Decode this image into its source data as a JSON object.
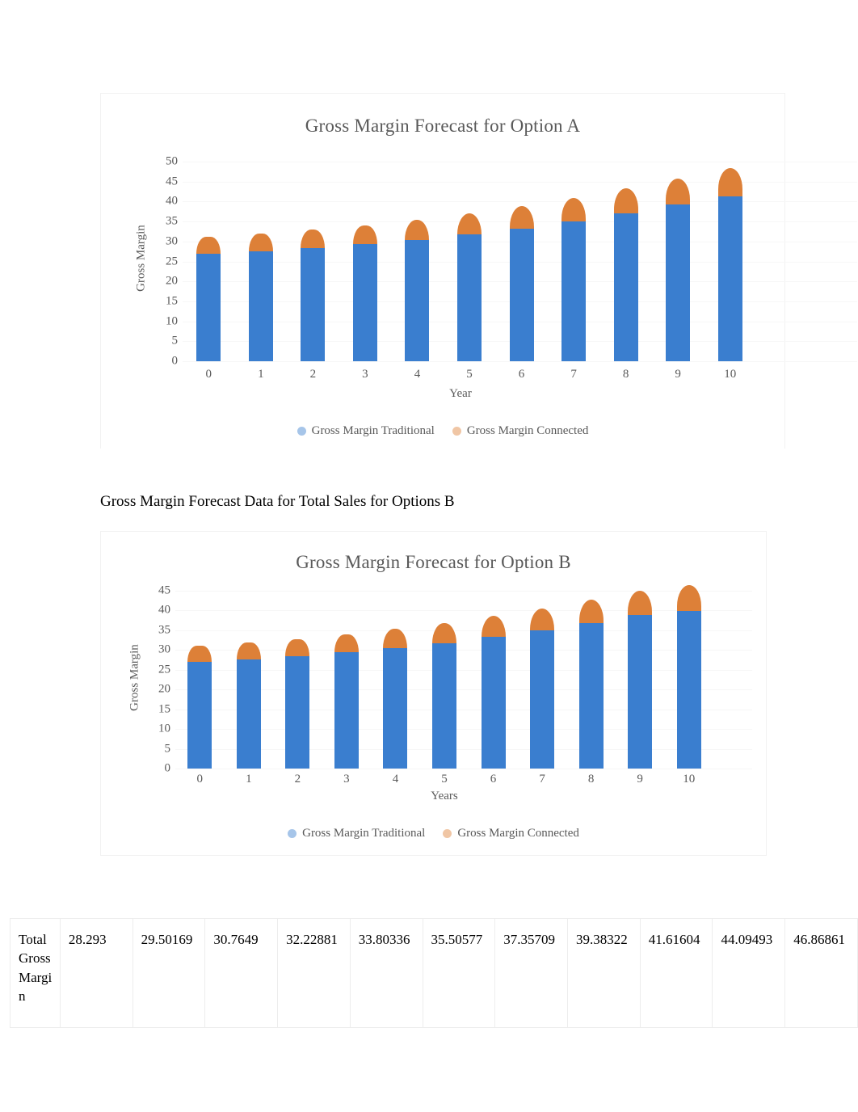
{
  "chart_data": [
    {
      "id": "option-a",
      "type": "bar",
      "stacked": true,
      "title": "Gross Margin Forecast for Option A",
      "xlabel": "Year",
      "ylabel": "Gross Margin",
      "categories": [
        "0",
        "1",
        "2",
        "3",
        "4",
        "5",
        "6",
        "7",
        "8",
        "9",
        "10"
      ],
      "ylim": [
        0,
        50
      ],
      "yticks": [
        "50",
        "45",
        "40",
        "35",
        "30",
        "25",
        "20",
        "15",
        "10",
        "5",
        "0"
      ],
      "grid": true,
      "legend_position": "bottom",
      "series": [
        {
          "name": "Gross Margin Traditional",
          "color": "#3a7ecf",
          "values": [
            26.9,
            27.6,
            28.3,
            29.3,
            30.4,
            31.7,
            33.2,
            35.0,
            37.0,
            39.2,
            41.3
          ]
        },
        {
          "name": "Gross Margin Connected",
          "color": "#dd8038",
          "values": [
            4.2,
            4.4,
            4.6,
            4.8,
            5.1,
            5.4,
            5.6,
            5.9,
            6.3,
            6.6,
            7.0
          ]
        }
      ]
    },
    {
      "id": "option-b",
      "type": "bar",
      "stacked": true,
      "title": "Gross Margin Forecast for Option B",
      "xlabel": "Years",
      "ylabel": "Gross Margin",
      "categories": [
        "0",
        "1",
        "2",
        "3",
        "4",
        "5",
        "6",
        "7",
        "8",
        "9",
        "10"
      ],
      "ylim": [
        0,
        45
      ],
      "yticks": [
        "45",
        "40",
        "35",
        "30",
        "25",
        "20",
        "15",
        "10",
        "5",
        "0"
      ],
      "grid": true,
      "legend_position": "bottom",
      "series": [
        {
          "name": "Gross Margin Traditional",
          "color": "#3a7ecf",
          "values": [
            27.0,
            27.7,
            28.4,
            29.4,
            30.5,
            31.8,
            33.3,
            35.0,
            36.9,
            38.9,
            39.9
          ]
        },
        {
          "name": "Gross Margin Connected",
          "color": "#dd8038",
          "values": [
            4.0,
            4.2,
            4.4,
            4.6,
            4.8,
            5.1,
            5.3,
            5.5,
            5.9,
            6.2,
            6.6
          ]
        }
      ]
    }
  ],
  "body_text": {
    "section_heading": "Gross Margin Forecast Data for Total Sales for Options B"
  },
  "table": {
    "row_label": "Total Gross Margin",
    "values": [
      "28.293",
      "29.50169",
      "30.7649",
      "32.22881",
      "33.80336",
      "35.50577",
      "37.35709",
      "39.38322",
      "41.61604",
      "44.09493",
      "46.86861"
    ]
  },
  "colors": {
    "traditional": "#3a7ecf",
    "connected": "#dd8038",
    "axis_text": "#595959",
    "gridline": "#f7f7f7"
  }
}
